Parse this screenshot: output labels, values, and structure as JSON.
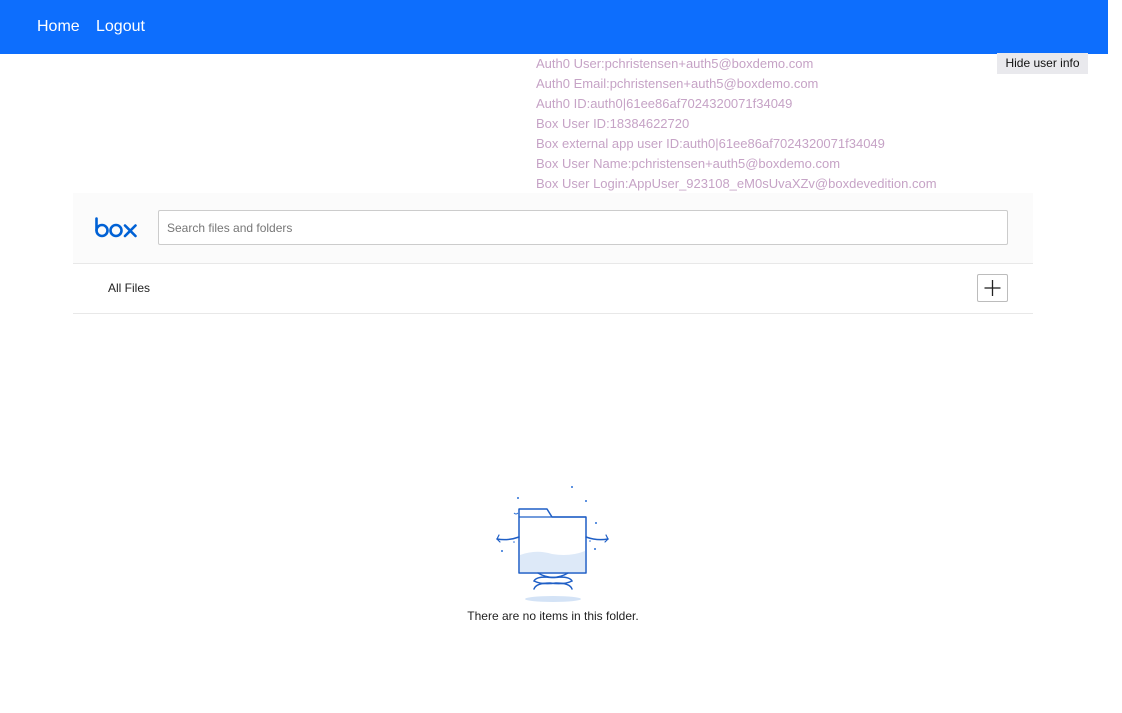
{
  "nav": {
    "home_label": "Home",
    "logout_label": "Logout"
  },
  "user_info": {
    "lines": [
      "Auth0 User:pchristensen+auth5@boxdemo.com",
      "Auth0 Email:pchristensen+auth5@boxdemo.com",
      "Auth0 ID:auth0|61ee86af7024320071f34049",
      "Box User ID:18384622720",
      "Box external app user ID:auth0|61ee86af7024320071f34049",
      "Box User Name:pchristensen+auth5@boxdemo.com",
      "Box User Login:AppUser_923108_eM0sUvaXZv@boxdevedition.com"
    ],
    "hide_button_label": "Hide user info"
  },
  "explorer": {
    "logo_icon": "box-logo",
    "search_placeholder": "Search files and folders",
    "breadcrumb": "All Files",
    "add_icon": "plus-icon",
    "empty_icon": "empty-folder-illustration",
    "empty_message": "There are no items in this folder."
  },
  "colors": {
    "navbar": "#0d6efd",
    "user_info_text": "#c6a3c6",
    "box_blue": "#0061d5"
  }
}
